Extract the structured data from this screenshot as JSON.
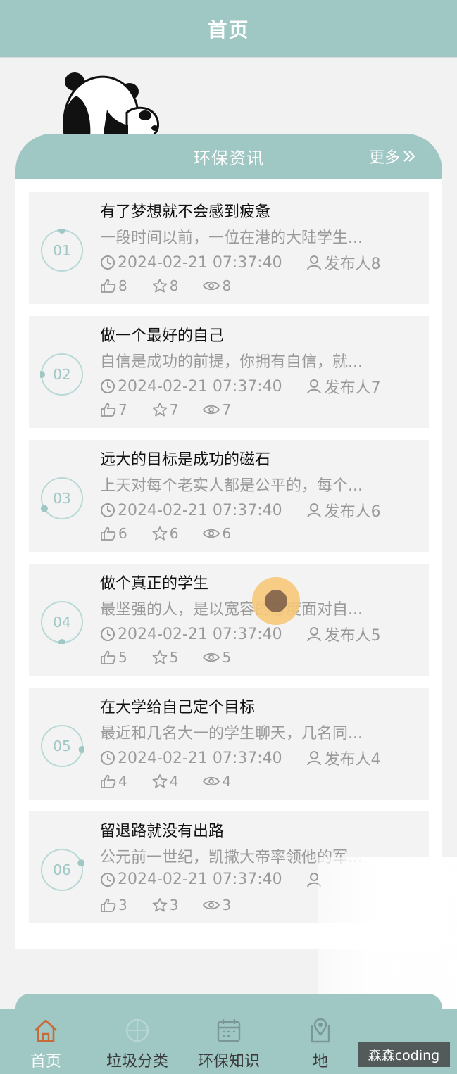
{
  "header": {
    "title": "首页"
  },
  "section": {
    "title": "环保资讯",
    "more": "更多"
  },
  "articles": [
    {
      "num": "01",
      "title": "有了梦想就不会感到疲惫",
      "excerpt": "一段时间以前，一位在港的大陆学生...",
      "date": "2024-02-21 07:37:40",
      "author": "发布人8",
      "likes": "8",
      "favs": "8",
      "views": "8"
    },
    {
      "num": "02",
      "title": "做一个最好的自己",
      "excerpt": "自信是成功的前提，你拥有自信，就...",
      "date": "2024-02-21 07:37:40",
      "author": "发布人7",
      "likes": "7",
      "favs": "7",
      "views": "7"
    },
    {
      "num": "03",
      "title": "远大的目标是成功的磁石",
      "excerpt": "上天对每个老实人都是公平的，每个...",
      "date": "2024-02-21 07:37:40",
      "author": "发布人6",
      "likes": "6",
      "favs": "6",
      "views": "6"
    },
    {
      "num": "04",
      "title": "做个真正的学生",
      "excerpt": "最坚强的人，是以宽容的态度面对自...",
      "date": "2024-02-21 07:37:40",
      "author": "发布人5",
      "likes": "5",
      "favs": "5",
      "views": "5"
    },
    {
      "num": "05",
      "title": "在大学给自己定个目标",
      "excerpt": "最近和几名大一的学生聊天，几名同...",
      "date": "2024-02-21 07:37:40",
      "author": "发布人4",
      "likes": "4",
      "favs": "4",
      "views": "4"
    },
    {
      "num": "06",
      "title": "留退路就没有出路",
      "excerpt": "公元前一世纪，凯撒大帝率领他的军...",
      "date": "2024-02-21 07:37:40",
      "author": "",
      "likes": "3",
      "favs": "3",
      "views": "3"
    }
  ],
  "tabs": [
    {
      "label": "首页",
      "icon": "home-icon"
    },
    {
      "label": "垃圾分类",
      "icon": "grid-icon"
    },
    {
      "label": "环保知识",
      "icon": "calendar-icon"
    },
    {
      "label": "地",
      "icon": "map-pin-icon"
    }
  ],
  "watermark": "森森coding",
  "colors": {
    "theme": "#9fc7c4",
    "active_tab": "#c96a3a",
    "text_gray": "#9a9a9a"
  }
}
